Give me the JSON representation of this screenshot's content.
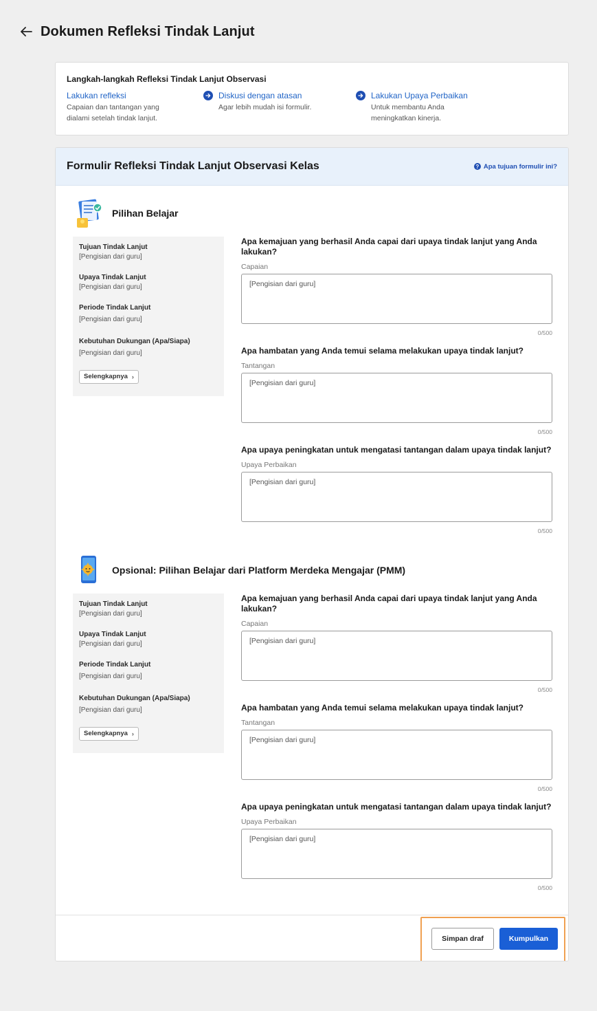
{
  "header": {
    "title": "Dokumen Refleksi Tindak Lanjut"
  },
  "steps": {
    "title": "Langkah-langkah Refleksi Tindak Lanjut Observasi",
    "items": [
      {
        "title": "Lakukan refleksi",
        "desc": "Capaian dan tantangan yang dialami setelah tindak lanjut."
      },
      {
        "title": "Diskusi dengan atasan",
        "desc": "Agar lebih mudah isi formulir."
      },
      {
        "title": "Lakukan Upaya Perbaikan",
        "desc": "Untuk membantu Anda meningkatkan kinerja."
      }
    ]
  },
  "form": {
    "title": "Formulir Refleksi Tindak Lanjut Observasi Kelas",
    "help_link": "Apa tujuan formulir ini?",
    "sections": [
      {
        "title": "Pilihan Belajar",
        "info": [
          {
            "label": "Tujuan Tindak Lanjut",
            "value": "[Pengisian dari guru]"
          },
          {
            "label": "Upaya Tindak Lanjut",
            "value": "[Pengisian dari guru]"
          },
          {
            "label": "Periode Tindak Lanjut",
            "value": "[Pengisian dari guru]"
          },
          {
            "label": "Kebutuhan Dukungan (Apa/Siapa)",
            "value": "[Pengisian dari guru]"
          }
        ],
        "more_button": "Selengkapnya",
        "questions": [
          {
            "question": "Apa kemajuan yang berhasil Anda capai dari upaya tindak lanjut yang Anda lakukan?",
            "label": "Capaian",
            "value": "[Pengisian dari guru]",
            "counter": "0/500"
          },
          {
            "question": "Apa hambatan yang Anda temui selama melakukan upaya tindak lanjut?",
            "label": "Tantangan",
            "value": "[Pengisian dari guru]",
            "counter": "0/500"
          },
          {
            "question": "Apa upaya peningkatan untuk mengatasi tantangan dalam upaya tindak lanjut?",
            "label": "Upaya Perbaikan",
            "value": "[Pengisian dari guru]",
            "counter": "0/500"
          }
        ]
      },
      {
        "title": "Opsional: Pilihan Belajar dari Platform Merdeka Mengajar (PMM)",
        "info": [
          {
            "label": "Tujuan Tindak Lanjut",
            "value": "[Pengisian dari guru]"
          },
          {
            "label": "Upaya Tindak Lanjut",
            "value": "[Pengisian dari guru]"
          },
          {
            "label": "Periode Tindak Lanjut",
            "value": "[Pengisian dari guru]"
          },
          {
            "label": "Kebutuhan Dukungan (Apa/Siapa)",
            "value": "[Pengisian dari guru]"
          }
        ],
        "more_button": "Selengkapnya",
        "questions": [
          {
            "question": "Apa kemajuan yang berhasil Anda capai dari upaya tindak lanjut yang Anda lakukan?",
            "label": "Capaian",
            "value": "[Pengisian dari guru]",
            "counter": "0/500"
          },
          {
            "question": "Apa hambatan yang Anda temui selama melakukan upaya tindak lanjut?",
            "label": "Tantangan",
            "value": "[Pengisian dari guru]",
            "counter": "0/500"
          },
          {
            "question": "Apa upaya peningkatan untuk mengatasi tantangan dalam upaya tindak lanjut?",
            "label": "Upaya Perbaikan",
            "value": "[Pengisian dari guru]",
            "counter": "0/500"
          }
        ]
      }
    ]
  },
  "footer": {
    "draft_label": "Simpan draf",
    "submit_label": "Kumpulkan"
  },
  "colors": {
    "accent": "#1a5fd6",
    "link": "#1f63c6",
    "highlight": "#f0a050"
  }
}
